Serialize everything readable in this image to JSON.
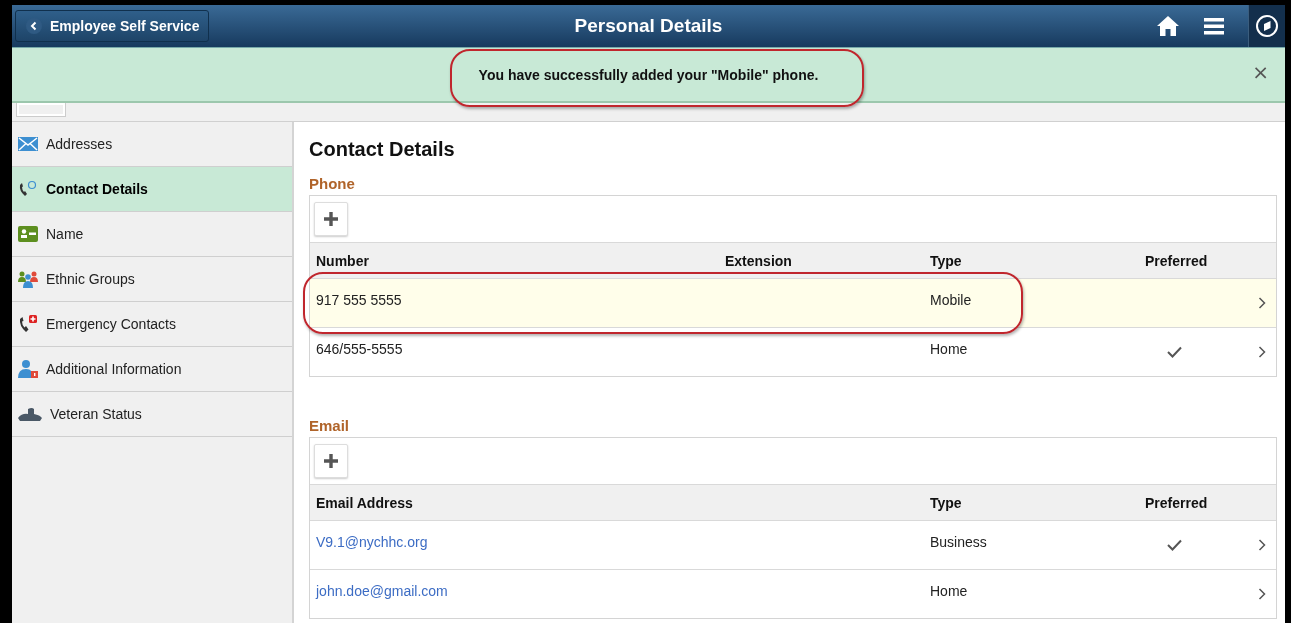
{
  "header": {
    "back_label": "Employee Self Service",
    "title": "Personal Details"
  },
  "banner": {
    "message": "You have successfully added your \"Mobile\" phone.",
    "close": "×"
  },
  "sidebar": {
    "items": [
      {
        "label": "Addresses",
        "selected": false
      },
      {
        "label": "Contact Details",
        "selected": true
      },
      {
        "label": "Name",
        "selected": false
      },
      {
        "label": "Ethnic Groups",
        "selected": false
      },
      {
        "label": "Emergency Contacts",
        "selected": false
      },
      {
        "label": "Additional Information",
        "selected": false
      },
      {
        "label": "Veteran Status",
        "selected": false
      }
    ]
  },
  "content": {
    "title": "Contact Details",
    "phone": {
      "label": "Phone",
      "columns": [
        "Number",
        "Extension",
        "Type",
        "Preferred"
      ],
      "rows": [
        {
          "number": "917 555 5555",
          "extension": "",
          "type": "Mobile",
          "preferred": false,
          "selected": true
        },
        {
          "number": "646/555-5555",
          "extension": "",
          "type": "Home",
          "preferred": true,
          "selected": false
        }
      ]
    },
    "email": {
      "label": "Email",
      "columns": [
        "Email Address",
        "Type",
        "Preferred"
      ],
      "rows": [
        {
          "address": "V9.1@nychhc.org",
          "type": "Business",
          "preferred": true
        },
        {
          "address": "john.doe@gmail.com",
          "type": "Home",
          "preferred": false
        }
      ]
    }
  }
}
